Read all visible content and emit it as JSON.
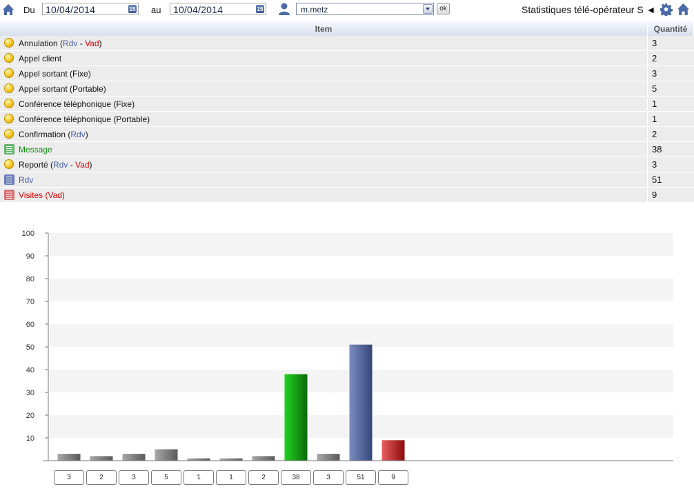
{
  "toolbar": {
    "from_label": "Du",
    "from_date": "10/04/2014",
    "to_label": "au",
    "to_date": "10/04/2014",
    "user_selected": "m.metz",
    "ok_label": "ok",
    "page_title": "Statistiques télé-opérateur S ◄",
    "calendar_glyph": "15"
  },
  "table": {
    "col_item": "Item",
    "col_qty": "Quantité",
    "rows": [
      {
        "icon": "ball",
        "parts": [
          {
            "t": "Annulation (",
            "c": "default"
          },
          {
            "t": "Rdv",
            "c": "blue"
          },
          {
            "t": " - ",
            "c": "default"
          },
          {
            "t": "Vad",
            "c": "red"
          },
          {
            "t": ")",
            "c": "default"
          }
        ],
        "qty": "3"
      },
      {
        "icon": "ball",
        "parts": [
          {
            "t": "Appel client",
            "c": "default"
          }
        ],
        "qty": "2"
      },
      {
        "icon": "ball",
        "parts": [
          {
            "t": "Appel sortant (Fixe)",
            "c": "default"
          }
        ],
        "qty": "3"
      },
      {
        "icon": "ball",
        "parts": [
          {
            "t": "Appel sortant (Portable)",
            "c": "default"
          }
        ],
        "qty": "5"
      },
      {
        "icon": "ball",
        "parts": [
          {
            "t": "Conférence téléphonique (Fixe)",
            "c": "default"
          }
        ],
        "qty": "1"
      },
      {
        "icon": "ball",
        "parts": [
          {
            "t": "Conférence téléphonique (Portable)",
            "c": "default"
          }
        ],
        "qty": "1"
      },
      {
        "icon": "ball",
        "parts": [
          {
            "t": "Confirmation (",
            "c": "default"
          },
          {
            "t": "Rdv",
            "c": "blue"
          },
          {
            "t": ")",
            "c": "default"
          }
        ],
        "qty": "2"
      },
      {
        "icon": "list-green",
        "parts": [
          {
            "t": "Message",
            "c": "green"
          }
        ],
        "qty": "38"
      },
      {
        "icon": "ball",
        "parts": [
          {
            "t": "Reporté (",
            "c": "default"
          },
          {
            "t": "Rdv",
            "c": "blue"
          },
          {
            "t": " - ",
            "c": "default"
          },
          {
            "t": "Vad",
            "c": "red"
          },
          {
            "t": ")",
            "c": "default"
          }
        ],
        "qty": "3"
      },
      {
        "icon": "list-blue",
        "parts": [
          {
            "t": "Rdv",
            "c": "blue"
          }
        ],
        "qty": "51"
      },
      {
        "icon": "list-red",
        "parts": [
          {
            "t": "Visites (Vad)",
            "c": "red"
          }
        ],
        "qty": "9"
      }
    ]
  },
  "colors": {
    "blue": "#4a5fa8",
    "red": "#d40000",
    "green": "#118a11",
    "icon_green": "#66b36a",
    "icon_blue": "#6a7cb8",
    "icon_red": "#d87070"
  },
  "chart_data": {
    "type": "bar",
    "title": "",
    "xlabel": "",
    "ylabel": "",
    "ylim": [
      0,
      100
    ],
    "yticks": [
      10,
      20,
      30,
      40,
      50,
      60,
      70,
      80,
      90,
      100
    ],
    "grid": "horizontal bands",
    "categories": [
      "Annulation (Rdv - Vad)",
      "Appel client",
      "Appel sortant (Fixe)",
      "Appel sortant (Portable)",
      "Conférence téléphonique (Fixe)",
      "Conférence téléphonique (Portable)",
      "Confirmation (Rdv)",
      "Message",
      "Reporté (Rdv - Vad)",
      "Rdv",
      "Visites (Vad)"
    ],
    "values": [
      3,
      2,
      3,
      5,
      1,
      1,
      2,
      38,
      3,
      51,
      9
    ],
    "bar_colors": [
      "gray",
      "gray",
      "gray",
      "gray",
      "gray",
      "gray",
      "gray",
      "green",
      "gray",
      "blue",
      "red"
    ],
    "value_labels": [
      "3",
      "2",
      "3",
      "5",
      "1",
      "1",
      "2",
      "38",
      "3",
      "51",
      "9"
    ]
  }
}
